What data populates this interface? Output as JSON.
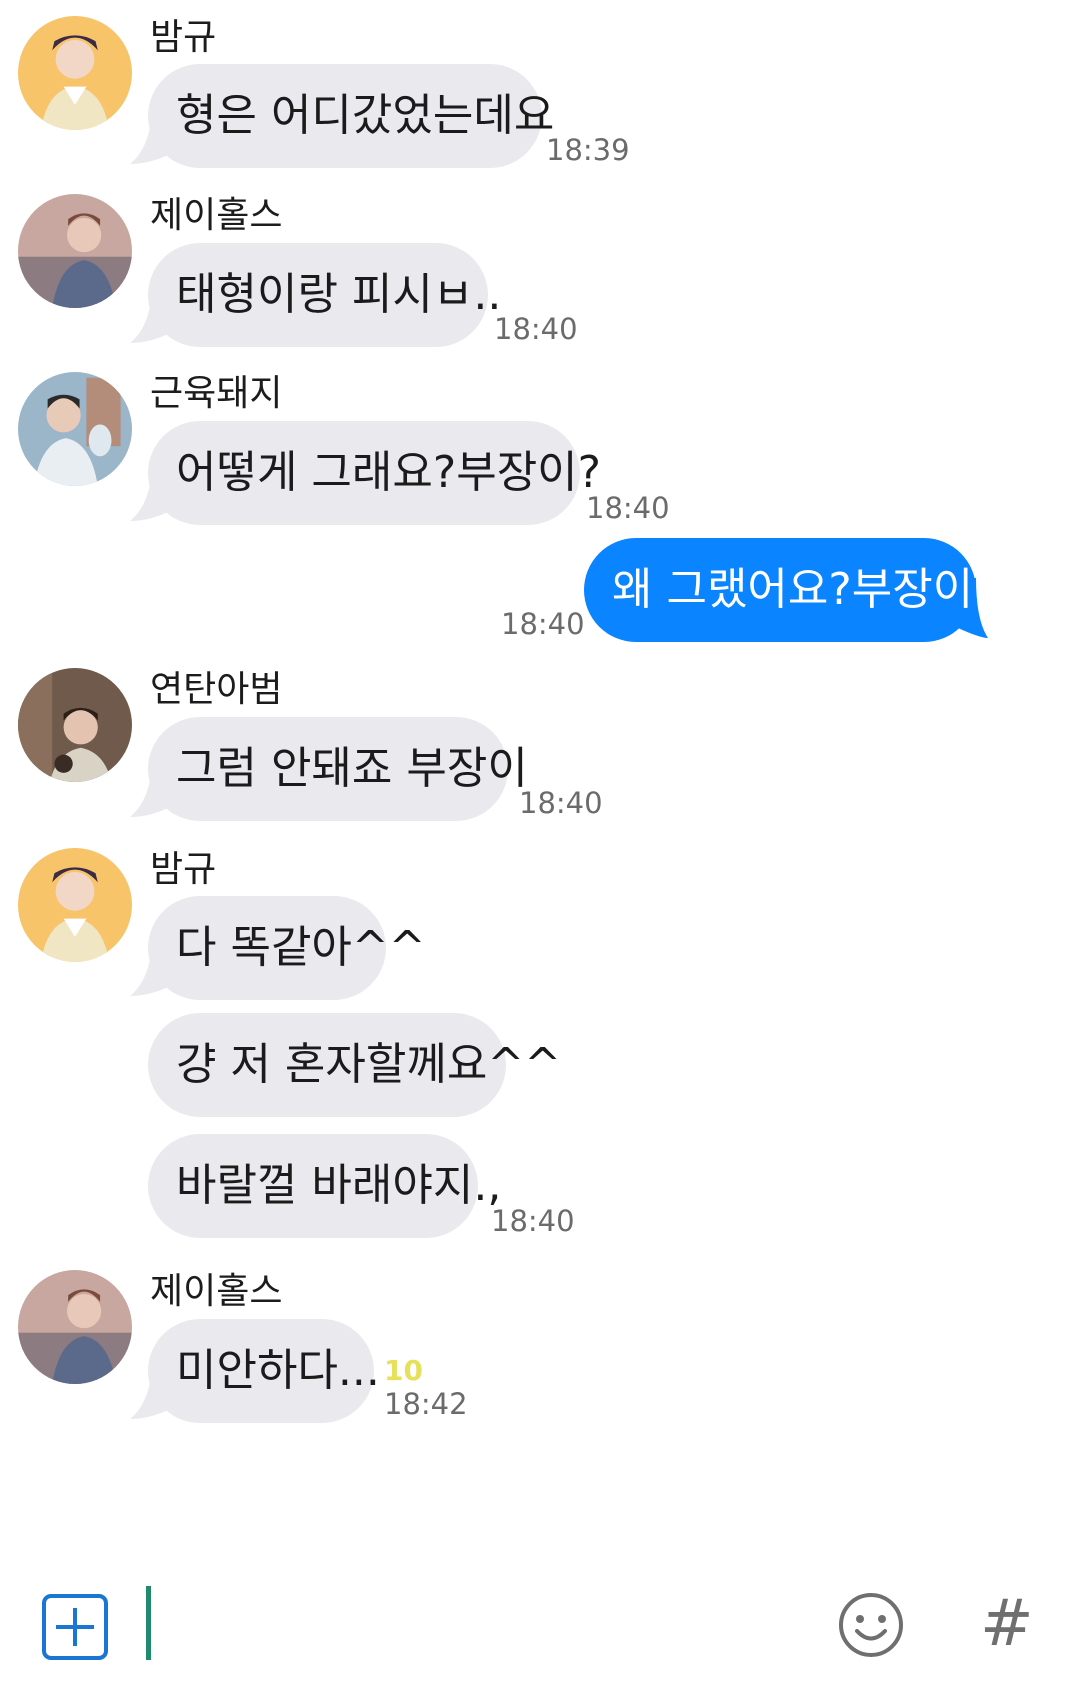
{
  "messages": [
    {
      "sender": "밤규",
      "avatar": "avatar-bamgyu",
      "text": "형은 어디갔었는데요",
      "time": "18:39"
    },
    {
      "sender": "제이홀스",
      "avatar": "avatar-jhope",
      "text": "태형이랑 피시ㅂ..",
      "time": "18:40"
    },
    {
      "sender": "근육돼지",
      "avatar": "avatar-muscle",
      "text": "어떻게 그래요?부장이?",
      "time": "18:40"
    },
    {
      "sender": "",
      "avatar": "",
      "text": "왜 그랬어요?부장이?",
      "time": "18:40",
      "mine": true
    },
    {
      "sender": "연탄아범",
      "avatar": "avatar-yeontan",
      "text": "그럼 안돼죠 부장이",
      "time": "18:40"
    },
    {
      "sender": "밤규",
      "avatar": "avatar-bamgyu",
      "text": "다 똑같아^^",
      "time": ""
    },
    {
      "sender": "",
      "avatar": "",
      "text": "걍 저 혼자할께요^^",
      "time": ""
    },
    {
      "sender": "",
      "avatar": "",
      "text": "바랄껄 바래야지.,",
      "time": "18:40"
    },
    {
      "sender": "제이홀스",
      "avatar": "avatar-jhope",
      "text": "미안하다...",
      "time": "18:42",
      "unread": "10"
    }
  ],
  "composer": {
    "placeholder": "",
    "plus_icon": "plus-icon",
    "emoji_icon": "smiley-icon",
    "hashtag_label": "#"
  },
  "colors": {
    "bubble_in": "#eaeaee",
    "bubble_out": "#0a84ff",
    "unread": "#e6e05a",
    "plus": "#1976d2",
    "caret": "#1f8a6e"
  }
}
